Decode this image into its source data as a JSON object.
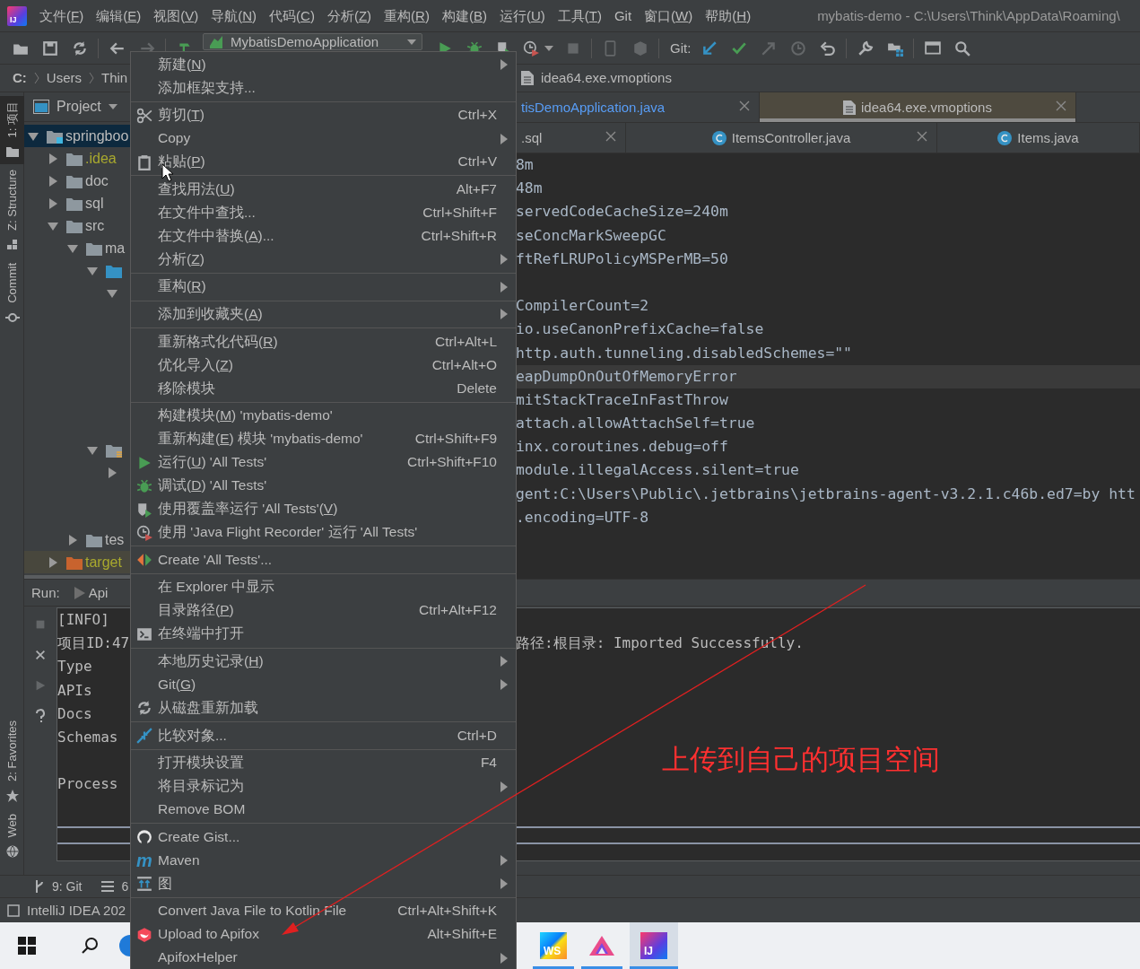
{
  "menubar": {
    "logo": "IJ",
    "items": [
      "文件(F)",
      "编辑(E)",
      "视图(V)",
      "导航(N)",
      "代码(C)",
      "分析(Z)",
      "重构(R)",
      "构建(B)",
      "运行(U)",
      "工具(T)",
      "Git",
      "窗口(W)",
      "帮助(H)"
    ],
    "title": "mybatis-demo - C:\\Users\\Think\\AppData\\Roaming\\"
  },
  "toolbar": {
    "run_config": "MybatisDemoApplication",
    "git_label": "Git:",
    "buttons": [
      {
        "kind": "open",
        "disabled": false
      },
      {
        "kind": "save",
        "disabled": false
      },
      {
        "kind": "sync",
        "disabled": false
      },
      {
        "kind": "separator"
      },
      {
        "kind": "back",
        "disabled": false
      },
      {
        "kind": "forward",
        "disabled": true
      },
      {
        "kind": "separator"
      },
      {
        "kind": "hammer",
        "disabled": false
      },
      {
        "kind": "runconfig"
      },
      {
        "kind": "run",
        "disabled": false
      },
      {
        "kind": "debug",
        "disabled": false
      },
      {
        "kind": "coverage",
        "disabled": false
      },
      {
        "kind": "profiler",
        "disabled": false
      },
      {
        "kind": "stop",
        "disabled": true
      },
      {
        "kind": "separator"
      },
      {
        "kind": "device",
        "disabled": true
      },
      {
        "kind": "cube",
        "disabled": true
      },
      {
        "kind": "separator"
      },
      {
        "kind": "gitlabel"
      },
      {
        "kind": "update",
        "disabled": false
      },
      {
        "kind": "commit",
        "disabled": false
      },
      {
        "kind": "push",
        "disabled": true
      },
      {
        "kind": "history",
        "disabled": true
      },
      {
        "kind": "revert",
        "disabled": false
      },
      {
        "kind": "separator"
      },
      {
        "kind": "wrench",
        "disabled": false
      },
      {
        "kind": "structure",
        "disabled": false
      },
      {
        "kind": "separator"
      },
      {
        "kind": "presentation",
        "disabled": false
      },
      {
        "kind": "search",
        "disabled": false
      }
    ]
  },
  "breadcrumb": {
    "parts": [
      "C:",
      "Users",
      "Thin"
    ],
    "file": "idea64.exe.vmoptions"
  },
  "tool_strip": {
    "top": [
      {
        "label": "1: 项目",
        "kind": "project",
        "selected": true
      },
      {
        "label": "Z: Structure",
        "kind": "structure",
        "selected": false
      },
      {
        "label": "Commit",
        "kind": "commit",
        "selected": false
      }
    ],
    "bottom": [
      {
        "label": "2: Favorites",
        "kind": "favorites",
        "selected": false
      },
      {
        "label": "Web",
        "kind": "web",
        "selected": false
      }
    ]
  },
  "project": {
    "header": "Project",
    "tree": [
      {
        "label": "springboo",
        "kind": "module",
        "expanded": true,
        "selected": true,
        "excluded": false,
        "children": [
          {
            "label": ".idea",
            "kind": "folder",
            "expanded": false,
            "selected": false,
            "excluded": true
          },
          {
            "label": "doc",
            "kind": "folder",
            "expanded": false,
            "selected": false,
            "excluded": false
          },
          {
            "label": "sql",
            "kind": "folder",
            "expanded": false,
            "selected": false,
            "excluded": false
          },
          {
            "label": "src",
            "kind": "folder",
            "expanded": true,
            "selected": false,
            "excluded": false,
            "children": [
              {
                "label": "ma",
                "kind": "folder",
                "expanded": true,
                "selected": false,
                "excluded": false,
                "children": [
                  {
                    "kind": "source",
                    "expanded": true,
                    "selected": false,
                    "children": [
                      {
                        "expanded": true,
                        "selected": false
                      }
                    ]
                  },
                  {
                    "kind": "resources",
                    "expanded": true,
                    "selected": false,
                    "children": [
                      {
                        "expanded": false,
                        "selected": false
                      }
                    ]
                  }
                ]
              },
              {
                "label": "tes",
                "kind": "folder",
                "expanded": false,
                "selected": false,
                "excluded": false
              }
            ]
          },
          {
            "label": "target",
            "kind": "output",
            "expanded": false,
            "selected": false,
            "excluded": true
          }
        ]
      }
    ]
  },
  "editor": {
    "tab_rows": [
      [
        {
          "label": "tisDemoApplication.java",
          "kind": "plain",
          "modified": true,
          "selected": false,
          "closable": true
        },
        {
          "label": "idea64.exe.vmoptions",
          "kind": "file",
          "modified": false,
          "selected": true,
          "closable": true
        }
      ],
      [
        {
          "label": ".sql",
          "kind": "plain",
          "modified": false,
          "selected": false,
          "closable": true
        },
        {
          "label": "ItemsController.java",
          "kind": "class",
          "modified": false,
          "selected": false,
          "closable": true
        },
        {
          "label": "Items.java",
          "kind": "class",
          "modified": false,
          "selected": false,
          "closable": false
        }
      ]
    ],
    "lines": [
      {
        "kind": "text",
        "text": "8m",
        "current": false
      },
      {
        "kind": "text",
        "text": "48m",
        "current": false
      },
      {
        "kind": "text",
        "text": "servedCodeCacheSize=240m",
        "current": false
      },
      {
        "kind": "text",
        "text": "seConcMarkSweepGC",
        "current": false
      },
      {
        "kind": "text",
        "text": "ftRefLRUPolicyMSPerMB=50",
        "current": false
      },
      {
        "kind": "blank",
        "current": false
      },
      {
        "kind": "text",
        "text": "CompilerCount=2",
        "current": false
      },
      {
        "kind": "text",
        "text": "io.useCanonPrefixCache=false",
        "current": false
      },
      {
        "kind": "text",
        "text": "http.auth.tunneling.disabledSchemes=\"\"",
        "current": false
      },
      {
        "kind": "text",
        "text": "eapDumpOnOutOfMemoryError",
        "current": true
      },
      {
        "kind": "text",
        "text": "mitStackTraceInFastThrow",
        "current": false
      },
      {
        "kind": "text",
        "text": "attach.allowAttachSelf=true",
        "current": false
      },
      {
        "kind": "text",
        "text": "inx.coroutines.debug=off",
        "current": false
      },
      {
        "kind": "text",
        "text": "module.illegalAccess.silent=true",
        "current": false
      },
      {
        "kind": "text",
        "text": "gent:C:\\Users\\Public\\.jetbrains\\jetbrains-agent-v3.2.1.c46b.ed7=by htt",
        "current": false
      },
      {
        "kind": "text",
        "text": ".encoding=UTF-8",
        "current": false
      }
    ]
  },
  "run_panel": {
    "label": "Run:",
    "tab": "Api",
    "tools": [
      {
        "kind": "stop",
        "disabled": true
      },
      {
        "kind": "close",
        "disabled": false
      },
      {
        "kind": "rerun",
        "disabled": true
      },
      {
        "kind": "help",
        "disabled": false
      }
    ],
    "console": [
      {
        "kind": "text",
        "text": "[INFO]"
      },
      {
        "kind": "text",
        "text": "项目ID:47",
        "tail": "路径:根目录: Imported Successfully."
      },
      {
        "kind": "text",
        "text": "Type"
      },
      {
        "kind": "text",
        "text": "APIs"
      },
      {
        "kind": "text",
        "text": "Docs"
      },
      {
        "kind": "text",
        "text": "Schemas"
      },
      {
        "kind": "blank"
      },
      {
        "kind": "text",
        "text": "Process"
      }
    ]
  },
  "bottom_tabs": [
    {
      "label": "9: Git",
      "kind": "git"
    },
    {
      "label": "6",
      "kind": "list"
    }
  ],
  "status_bar": {
    "text": "IntelliJ IDEA 202"
  },
  "taskbar": {
    "apps": [
      {
        "kind": "webstorm",
        "label": "WS",
        "running": true,
        "selected": false
      },
      {
        "kind": "apifox",
        "running": true,
        "selected": false
      },
      {
        "kind": "intellij",
        "label": "IJ",
        "running": true,
        "selected": true
      }
    ]
  },
  "context_menu": [
    {
      "kind": "plain",
      "label": "新建(N)",
      "submenu": true
    },
    {
      "kind": "plain",
      "label": "添加框架支持...",
      "submenu": false
    },
    {
      "kind": "separator"
    },
    {
      "kind": "cut",
      "label": "剪切(T)",
      "shortcut": "Ctrl+X",
      "submenu": false
    },
    {
      "kind": "plain",
      "label": "Copy",
      "submenu": true
    },
    {
      "kind": "paste",
      "label": "粘贴(P)",
      "shortcut": "Ctrl+V",
      "submenu": false
    },
    {
      "kind": "separator"
    },
    {
      "kind": "plain",
      "label": "查找用法(U)",
      "shortcut": "Alt+F7",
      "submenu": false
    },
    {
      "kind": "plain",
      "label": "在文件中查找...",
      "shortcut": "Ctrl+Shift+F",
      "submenu": false
    },
    {
      "kind": "plain",
      "label": "在文件中替换(A)...",
      "shortcut": "Ctrl+Shift+R",
      "submenu": false
    },
    {
      "kind": "plain",
      "label": "分析(Z)",
      "submenu": true
    },
    {
      "kind": "separator"
    },
    {
      "kind": "plain",
      "label": "重构(R)",
      "submenu": true
    },
    {
      "kind": "separator"
    },
    {
      "kind": "plain",
      "label": "添加到收藏夹(A)",
      "submenu": true
    },
    {
      "kind": "separator"
    },
    {
      "kind": "plain",
      "label": "重新格式化代码(R)",
      "shortcut": "Ctrl+Alt+L",
      "submenu": false
    },
    {
      "kind": "plain",
      "label": "优化导入(Z)",
      "shortcut": "Ctrl+Alt+O",
      "submenu": false
    },
    {
      "kind": "plain",
      "label": "移除模块",
      "shortcut": "Delete",
      "submenu": false
    },
    {
      "kind": "separator"
    },
    {
      "kind": "plain",
      "label": "构建模块(M) 'mybatis-demo'",
      "submenu": false
    },
    {
      "kind": "plain",
      "label": "重新构建(E) 模块 'mybatis-demo'",
      "shortcut": "Ctrl+Shift+F9",
      "submenu": false
    },
    {
      "kind": "run",
      "label": "运行(U) 'All Tests'",
      "shortcut": "Ctrl+Shift+F10",
      "submenu": false
    },
    {
      "kind": "debug",
      "label": "调试(D) 'All Tests'",
      "submenu": false
    },
    {
      "kind": "coverage",
      "label": "使用覆盖率运行  'All Tests'(V)",
      "submenu": false
    },
    {
      "kind": "profiler",
      "label": "使用 'Java Flight Recorder' 运行 'All Tests'",
      "submenu": false
    },
    {
      "kind": "separator"
    },
    {
      "kind": "create",
      "label": "Create 'All Tests'...",
      "submenu": false
    },
    {
      "kind": "separator"
    },
    {
      "kind": "plain",
      "label": "在 Explorer 中显示",
      "submenu": false
    },
    {
      "kind": "plain",
      "label": "目录路径(P)",
      "shortcut": "Ctrl+Alt+F12",
      "submenu": false
    },
    {
      "kind": "terminal",
      "label": "在终端中打开",
      "submenu": false
    },
    {
      "kind": "separator"
    },
    {
      "kind": "plain",
      "label": "本地历史记录(H)",
      "submenu": true
    },
    {
      "kind": "plain",
      "label": "Git(G)",
      "submenu": true
    },
    {
      "kind": "reload",
      "label": "从磁盘重新加载",
      "submenu": false
    },
    {
      "kind": "separator"
    },
    {
      "kind": "compare",
      "label": "比较对象...",
      "shortcut": "Ctrl+D",
      "submenu": false
    },
    {
      "kind": "separator"
    },
    {
      "kind": "plain",
      "label": "打开模块设置",
      "shortcut": "F4",
      "submenu": false
    },
    {
      "kind": "plain",
      "label": "将目录标记为",
      "submenu": true
    },
    {
      "kind": "plain",
      "label": "Remove BOM",
      "submenu": false
    },
    {
      "kind": "separator"
    },
    {
      "kind": "gist",
      "label": "Create Gist...",
      "submenu": false
    },
    {
      "kind": "maven",
      "label": "Maven",
      "glyph": "m",
      "submenu": true
    },
    {
      "kind": "diagram",
      "label": "图",
      "submenu": true
    },
    {
      "kind": "separator"
    },
    {
      "kind": "plain",
      "label": "Convert Java File to Kotlin File",
      "shortcut": "Ctrl+Alt+Shift+K",
      "submenu": false
    },
    {
      "kind": "apifox",
      "label": "Upload to Apifox",
      "shortcut": "Alt+Shift+E",
      "submenu": false
    },
    {
      "kind": "plain",
      "label": "ApifoxHelper",
      "submenu": true
    }
  ],
  "annotation": {
    "text": "上传到自己的项目空间"
  }
}
